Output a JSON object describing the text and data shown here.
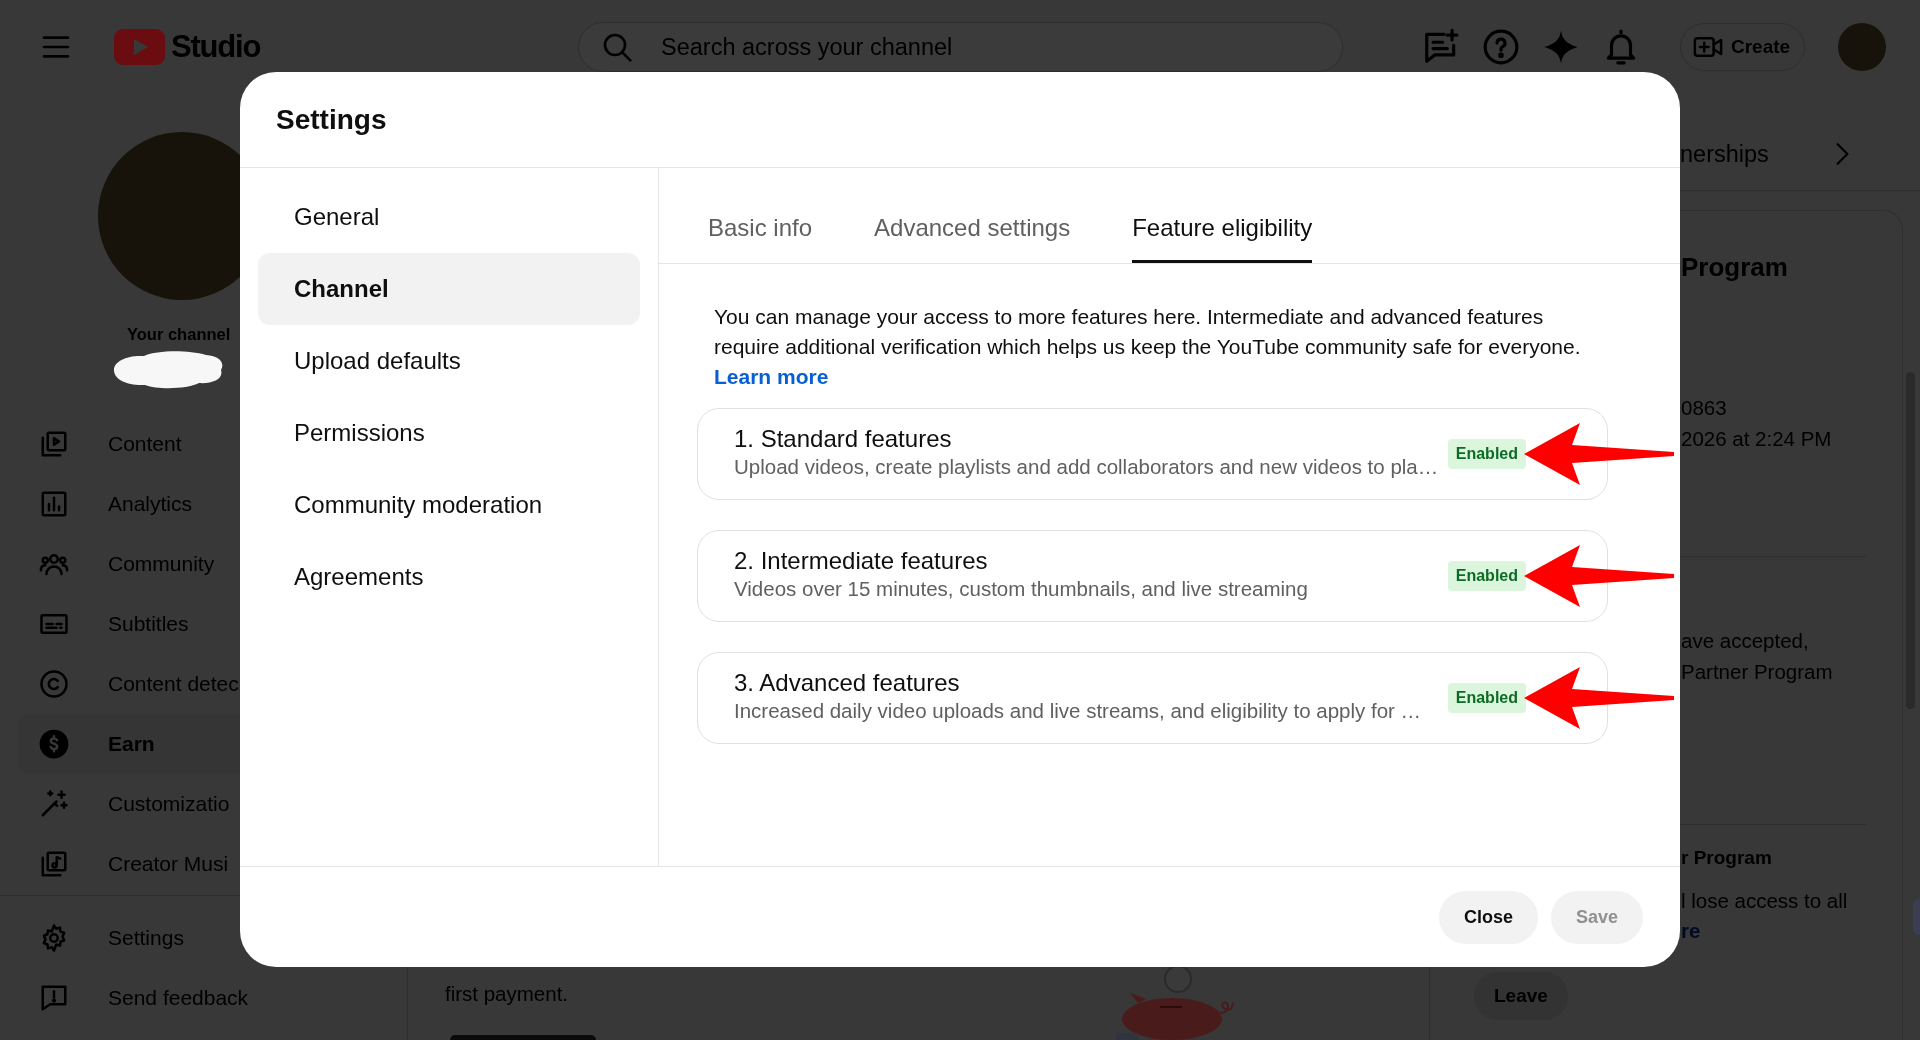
{
  "top_bar": {
    "logo_text": "Studio",
    "search": {
      "placeholder": "Search across your channel"
    },
    "create_label": "Create"
  },
  "sidebar": {
    "profile_label": "Your channel",
    "items": [
      {
        "kind": "content",
        "label": "Content",
        "selected": false
      },
      {
        "kind": "analytics",
        "label": "Analytics",
        "selected": false
      },
      {
        "kind": "community",
        "label": "Community",
        "selected": false
      },
      {
        "kind": "subtitles",
        "label": "Subtitles",
        "selected": false
      },
      {
        "kind": "copyright",
        "label": "Content detec",
        "selected": false
      },
      {
        "kind": "earn",
        "label": "Earn",
        "selected": true
      },
      {
        "kind": "customization",
        "label": "Customizatio",
        "selected": false
      },
      {
        "kind": "music",
        "label": "Creator Musi",
        "selected": false
      }
    ],
    "footer_items": [
      {
        "kind": "settings",
        "label": "Settings",
        "selected": false
      },
      {
        "kind": "feedback",
        "label": "Send feedback",
        "selected": false
      }
    ]
  },
  "main": {
    "paragraph": "first payment."
  },
  "right_panel": {
    "tab": "nerships",
    "card_title": "Program",
    "details": [
      "0863",
      "2026 at 2:24 PM"
    ],
    "section_lines": [
      "ave accepted,",
      "Partner Program"
    ],
    "section_title": "r Program",
    "section_text": "l lose access to all",
    "section_link": "re",
    "leave_button": "Leave"
  },
  "dialog": {
    "title": "Settings",
    "nav": [
      {
        "label": "General",
        "selected": false
      },
      {
        "label": "Channel",
        "selected": true
      },
      {
        "label": "Upload defaults",
        "selected": false
      },
      {
        "label": "Permissions",
        "selected": false
      },
      {
        "label": "Community moderation",
        "selected": false
      },
      {
        "label": "Agreements",
        "selected": false
      }
    ],
    "tabs": [
      {
        "label": "Basic info",
        "selected": false
      },
      {
        "label": "Advanced settings",
        "selected": false
      },
      {
        "label": "Feature eligibility",
        "selected": true
      }
    ],
    "intro": "You can manage your access to more features here. Intermediate and advanced features require additional verification which helps us keep the YouTube community safe for everyone.",
    "learn_more": "Learn more",
    "features": [
      {
        "title": "1. Standard features",
        "description": "Upload videos, create playlists and add collaborators and new videos to pla…",
        "status": "Enabled",
        "enabled": true,
        "arrow_annotation": true
      },
      {
        "title": "2. Intermediate features",
        "description": "Videos over 15 minutes, custom thumbnails, and live streaming",
        "status": "Enabled",
        "enabled": true,
        "arrow_annotation": true
      },
      {
        "title": "3. Advanced features",
        "description": "Increased daily video uploads and live streams, and eligibility to apply for …",
        "status": "Enabled",
        "enabled": true,
        "arrow_annotation": true
      }
    ],
    "buttons": [
      {
        "label": "Close",
        "disabled": false
      },
      {
        "label": "Save",
        "disabled": true
      }
    ]
  }
}
